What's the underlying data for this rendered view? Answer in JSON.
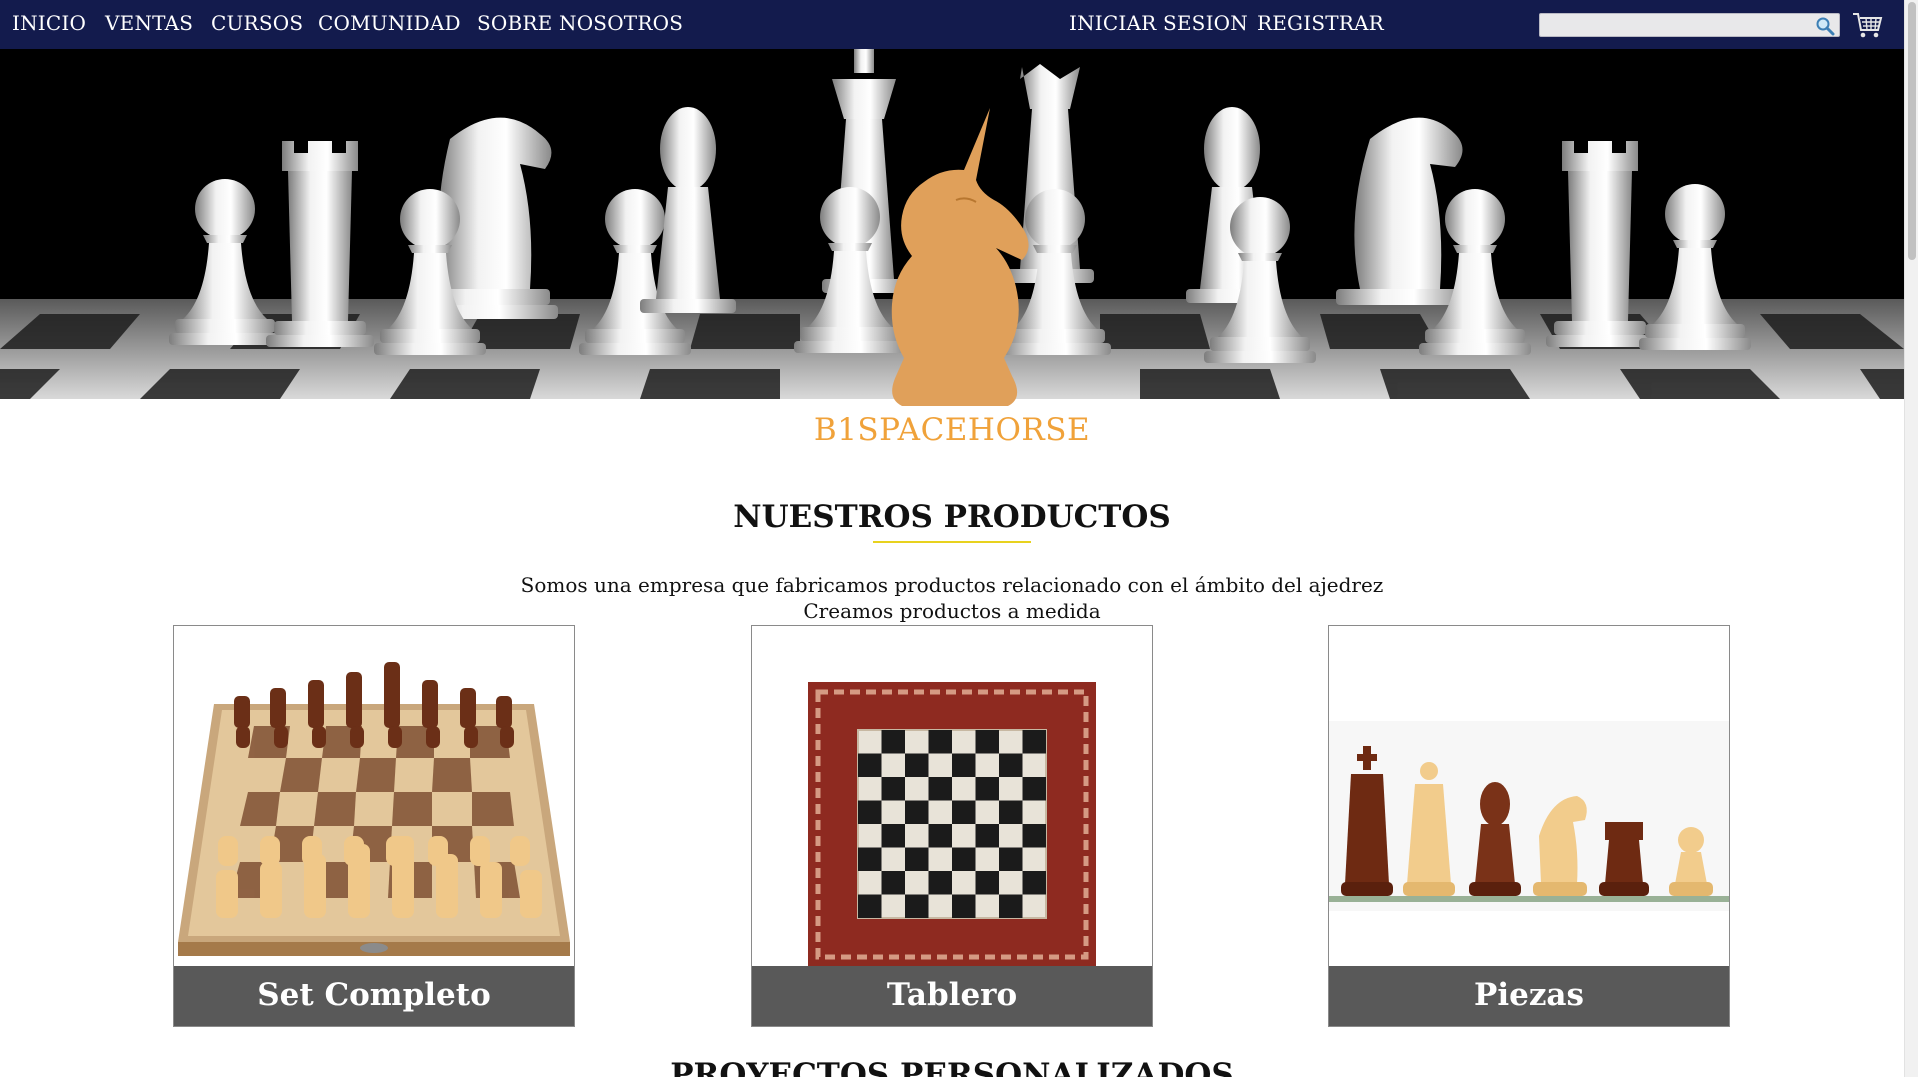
{
  "nav": {
    "left_links": [
      "INICIO",
      "VENTAS",
      "CURSOS",
      "COMUNIDAD",
      "SOBRE NOSOTROS"
    ],
    "right_links": [
      "INICIAR SESION",
      "REGISTRAR"
    ],
    "search": {
      "value": "",
      "placeholder": "",
      "icon": "search-icon"
    },
    "cart_icon": "cart-icon"
  },
  "hero": {
    "brand": "B1SPACEHORSE",
    "logo_icon": "unicorn-knight-icon"
  },
  "products": {
    "title": "NUESTROS PRODUCTOS",
    "intro_line_1": "Somos una empresa que fabricamos productos relacionado con el ámbito del ajedrez",
    "intro_line_2": "Creamos productos a medida",
    "cards": [
      {
        "label": "Set Completo",
        "image": "chess-set-image"
      },
      {
        "label": "Tablero",
        "image": "chess-board-image"
      },
      {
        "label": "Piezas",
        "image": "chess-pieces-image"
      }
    ]
  },
  "next_section_title": "PROYECTOS PERSONALIZADOS",
  "colors": {
    "nav_background": "#131b4d",
    "brand_accent": "#f0a23a",
    "title_underline": "#e8d21e",
    "card_label_background": "#595959"
  }
}
